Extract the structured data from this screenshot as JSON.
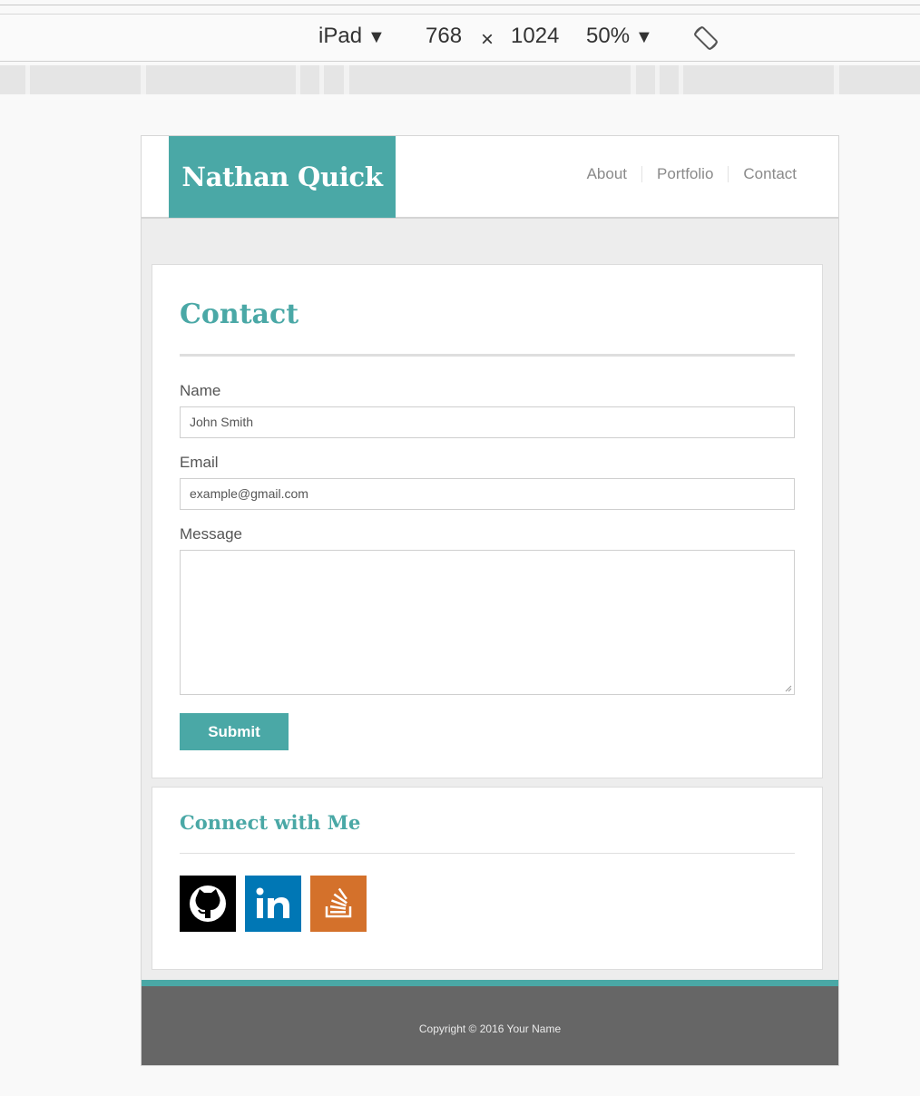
{
  "devtools": {
    "device": "iPad",
    "width": "768",
    "times": "×",
    "height": "1024",
    "zoom": "50%",
    "caret": "▼",
    "rotate_icon": "rotate-icon"
  },
  "site": {
    "brand": "Nathan Quick",
    "nav": [
      "About",
      "Portfolio",
      "Contact"
    ]
  },
  "contact": {
    "title": "Contact",
    "name_label": "Name",
    "name_value": "John Smith",
    "email_label": "Email",
    "email_value": "example@gmail.com",
    "message_label": "Message",
    "submit_label": "Submit"
  },
  "connect": {
    "title": "Connect with Me",
    "icons": [
      "github-icon",
      "linkedin-icon",
      "stack-overflow-icon"
    ]
  },
  "footer": {
    "copyright": "Copyright © 2016 Your Name"
  },
  "colors": {
    "accent": "#4aa8a6",
    "footer": "#666666",
    "linkedin": "#0077b5",
    "stackoverflow": "#d4712b"
  }
}
